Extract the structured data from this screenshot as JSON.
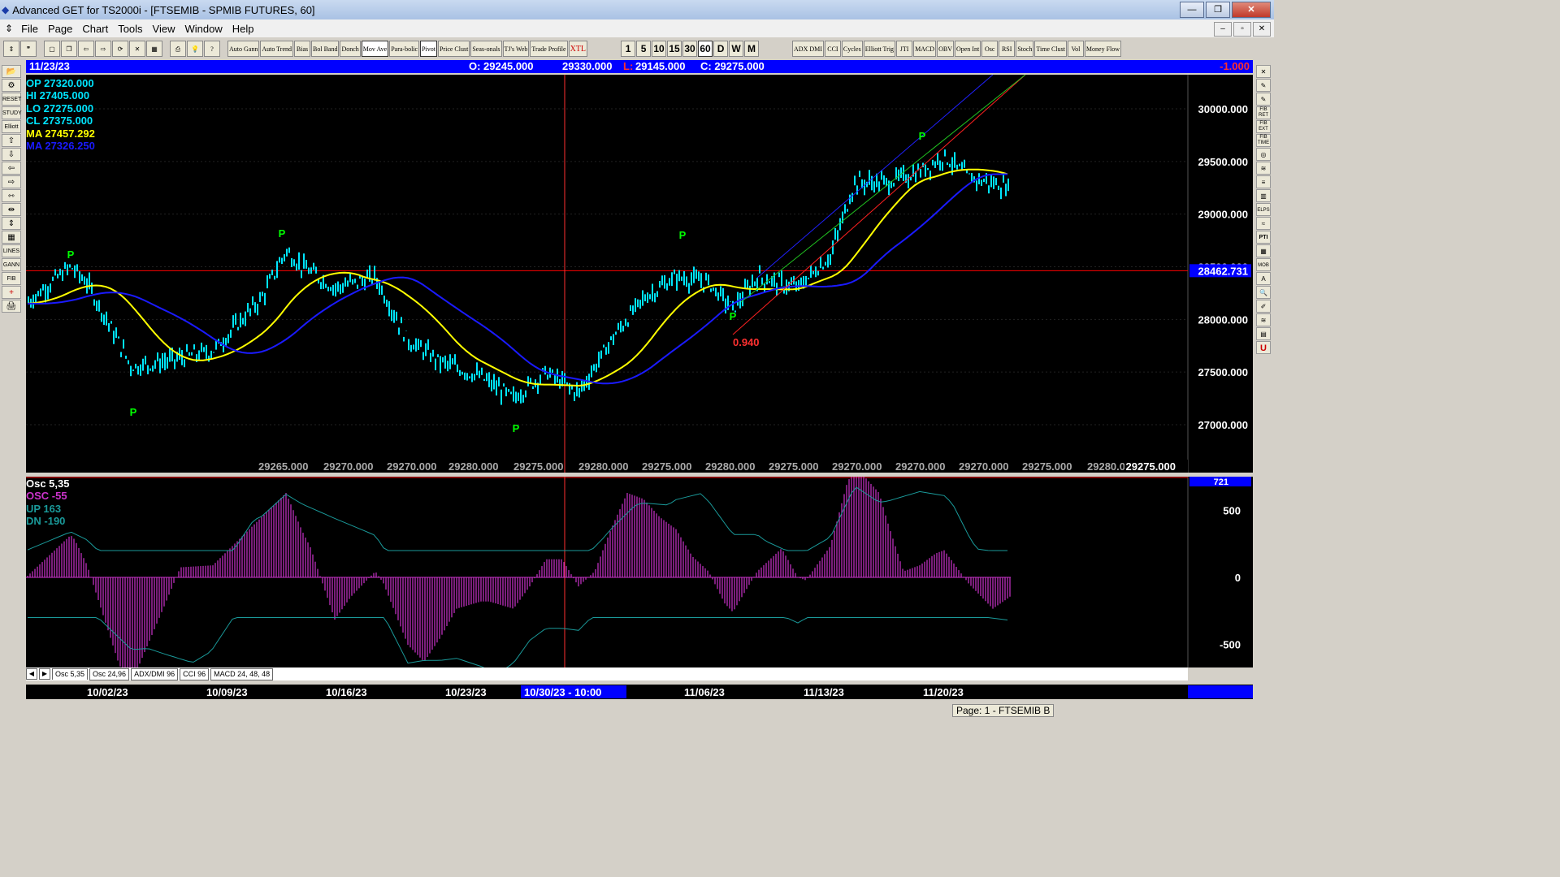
{
  "window": {
    "title": "Advanced GET for TS2000i - [FTSEMIB - SPMIB FUTURES, 60]",
    "buttons": [
      "—",
      "❐",
      "✕"
    ],
    "mdi_buttons": [
      "–",
      "▫",
      "✕"
    ]
  },
  "menu": [
    "File",
    "Page",
    "Chart",
    "Tools",
    "View",
    "Window",
    "Help"
  ],
  "toolbar": {
    "studies": [
      "Auto Gann",
      "Auto Trend",
      "Bias",
      "Bol Band",
      "Donch",
      "Mov Ave",
      "Para-bolic",
      "Pivot",
      "Price Clust",
      "Seas-onals",
      "TJ's Web",
      "Trade Profile",
      "XTL"
    ],
    "periods": [
      "1",
      "5",
      "10",
      "15",
      "30",
      "60",
      "D",
      "W",
      "M"
    ],
    "selected_period": "60",
    "indicators": [
      "ADX DMI",
      "CCI",
      "Cycles",
      "Elliott Trig",
      "JTI",
      "MACD",
      "OBV",
      "Open Int",
      "Osc",
      "RSI",
      "Stoch",
      "Time Clust",
      "Vol",
      "Money Flow"
    ]
  },
  "infobar": {
    "date": "11/23/23",
    "open": "O: 29245.000",
    "high": "29330.000",
    "low_label": "L:",
    "low": "29145.000",
    "close": "C: 29275.000",
    "change": "-1.000"
  },
  "legend": {
    "op": "OP  27320.000",
    "hi": "HI   27405.000",
    "lo": "LO  27275.000",
    "cl": "CL  27375.000",
    "ma1": "MA  27457.292",
    "ma2": "MA  27326.250"
  },
  "osc_legend": {
    "title": "Osc 5,35",
    "osc": "OSC -55",
    "up": "UP   163",
    "dn": "DN   -190"
  },
  "colors": {
    "price": "#00e5ff",
    "ma_fast": "#ffff00",
    "ma_slow": "#1a1aff",
    "osc": "#cc33cc",
    "pivot": "#00ff00",
    "hline": "#ff0000",
    "cursor": "#ff3030"
  },
  "price_axis": [
    "30000.000",
    "29500.000",
    "29000.000",
    "28500.000",
    "28000.000",
    "27500.000",
    "27000.000"
  ],
  "price_marker": "28462.731",
  "fib_label": "0.940",
  "bottom_values": [
    "29265.000",
    "29270.000",
    "29270.000",
    "29280.000",
    "29275.000",
    "29280.000",
    "29275.000",
    "29280.000",
    "29275.000",
    "29270.000",
    "29270.000",
    "29270.000",
    "29275.000",
    "29280.000"
  ],
  "bottom_current": "29275.000",
  "osc_axis": [
    "500",
    "0",
    "-500"
  ],
  "osc_top_marker": "721",
  "tabs": [
    "Osc 5,35",
    "Osc 24,96",
    "ADX/DMI 96",
    "CCI 96",
    "MACD 24, 48, 48"
  ],
  "dates": [
    "10/02/23",
    "10/09/23",
    "10/16/23",
    "10/23/23",
    "10/30/23 - 10:00",
    "11/06/23",
    "11/13/23",
    "11/20/23"
  ],
  "pivot_label": "P",
  "status": "Page: 1 - FTSEMIB B",
  "left_tools": [
    "📂",
    "⚙",
    "RESET",
    "STUDY",
    "Elliott",
    "⇧",
    "⇩",
    "⇦",
    "⇨",
    "⇿",
    "⇹",
    "⇕",
    "▦",
    "LINES",
    "GANN",
    "FIB",
    "+",
    "🖨"
  ],
  "right_tools": [
    "✕",
    "✎",
    "✎",
    "FIB RET",
    "FIB EXT",
    "FIB TIME",
    "◎",
    "≋",
    "≡",
    "▥",
    "ELPS",
    "≈",
    "PTI",
    "▦",
    "MOB",
    "A",
    "🔍",
    "✐",
    "≋",
    "▤",
    "U"
  ]
}
